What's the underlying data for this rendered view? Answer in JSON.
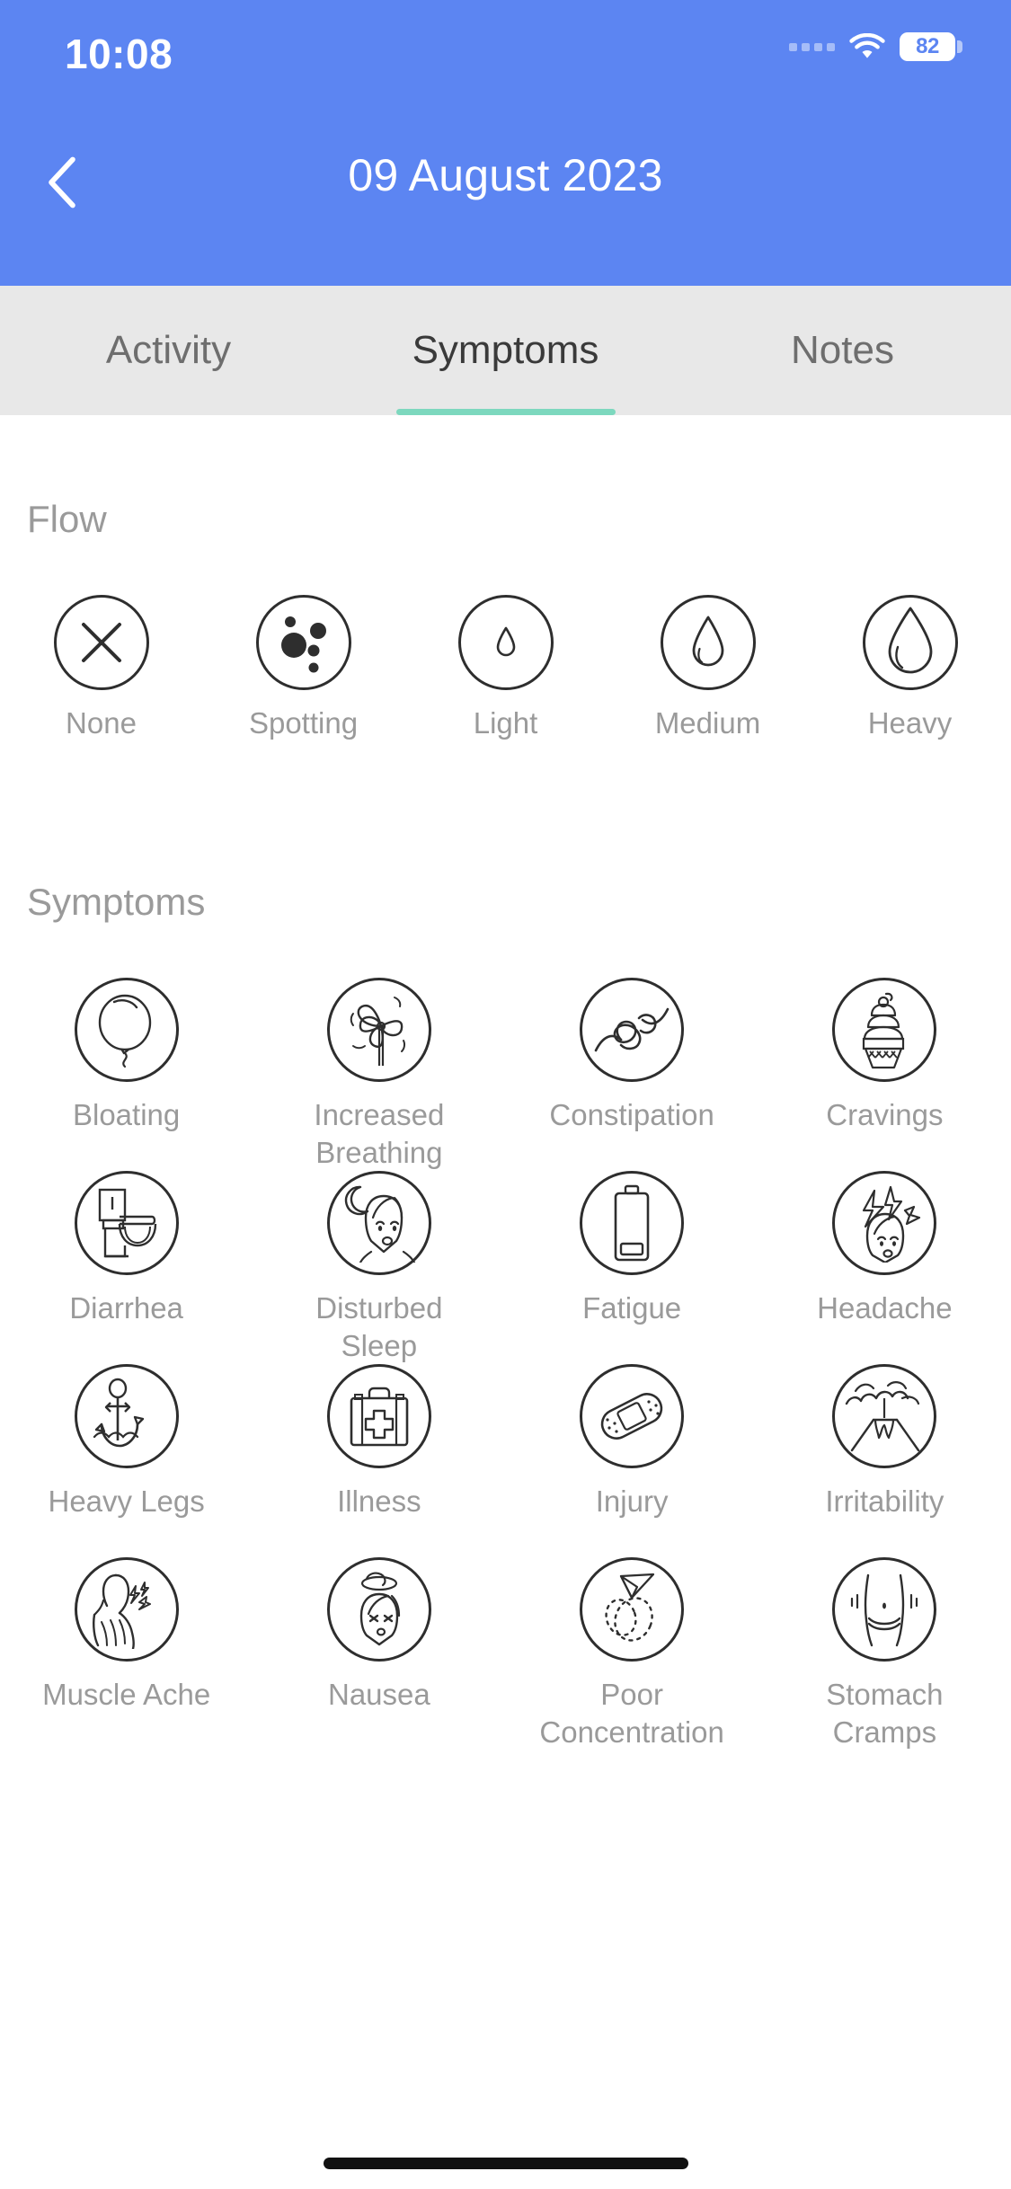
{
  "status_bar": {
    "time": "10:08",
    "battery_level": "82",
    "icons": [
      "signal-dots-icon",
      "wifi-icon",
      "battery-icon"
    ]
  },
  "header": {
    "back_icon": "chevron-left-icon",
    "title": "09 August 2023",
    "background_color": "#5C85F2"
  },
  "tabs": {
    "active_index": 1,
    "active_indicator_color": "#7DD8BE",
    "items": [
      {
        "label": "Activity"
      },
      {
        "label": "Symptoms"
      },
      {
        "label": "Notes"
      }
    ]
  },
  "flow": {
    "section_title": "Flow",
    "selected": null,
    "options": [
      {
        "label": "None",
        "icon": "cross-icon"
      },
      {
        "label": "Spotting",
        "icon": "dots-icon"
      },
      {
        "label": "Light",
        "icon": "small-droplet-icon"
      },
      {
        "label": "Medium",
        "icon": "medium-droplet-icon"
      },
      {
        "label": "Heavy",
        "icon": "large-droplet-icon"
      }
    ]
  },
  "symptoms": {
    "section_title": "Symptoms",
    "selected": [],
    "items": [
      {
        "label": "Bloating",
        "icon": "balloon-icon"
      },
      {
        "label": "Increased Breathing",
        "icon": "pinwheel-icon"
      },
      {
        "label": "Constipation",
        "icon": "knot-icon"
      },
      {
        "label": "Cravings",
        "icon": "ice-cream-icon"
      },
      {
        "label": "Diarrhea",
        "icon": "toilet-icon"
      },
      {
        "label": "Disturbed Sleep",
        "icon": "moon-face-icon"
      },
      {
        "label": "Fatigue",
        "icon": "low-battery-icon"
      },
      {
        "label": "Headache",
        "icon": "head-lightning-icon"
      },
      {
        "label": "Heavy Legs",
        "icon": "anchor-icon"
      },
      {
        "label": "Illness",
        "icon": "first-aid-kit-icon"
      },
      {
        "label": "Injury",
        "icon": "bandage-icon"
      },
      {
        "label": "Irritability",
        "icon": "volcano-icon"
      },
      {
        "label": "Muscle Ache",
        "icon": "back-pain-icon"
      },
      {
        "label": "Nausea",
        "icon": "dizzy-face-icon"
      },
      {
        "label": "Poor Concentration",
        "icon": "paper-plane-icon"
      },
      {
        "label": "Stomach Cramps",
        "icon": "belly-icon"
      }
    ]
  },
  "home_indicator": "home-indicator-bar"
}
